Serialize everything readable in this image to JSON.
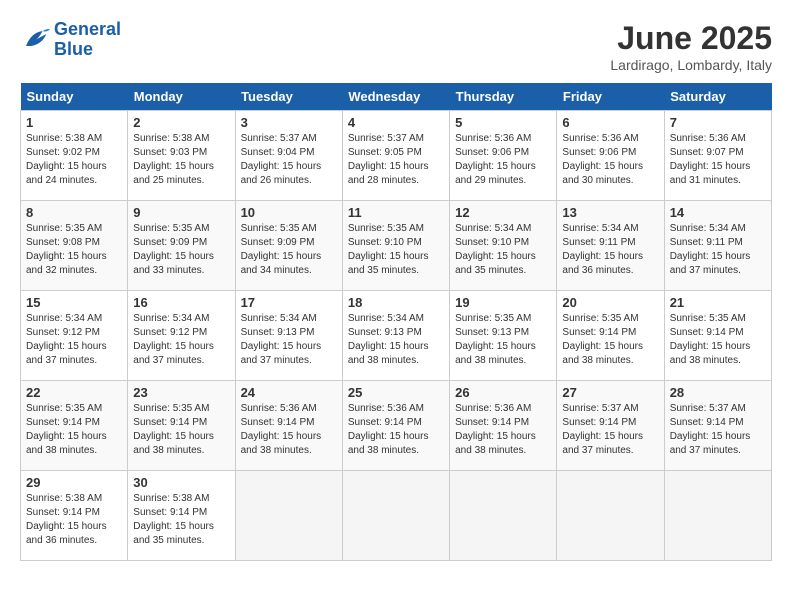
{
  "header": {
    "logo_line1": "General",
    "logo_line2": "Blue",
    "month": "June 2025",
    "location": "Lardirago, Lombardy, Italy"
  },
  "weekdays": [
    "Sunday",
    "Monday",
    "Tuesday",
    "Wednesday",
    "Thursday",
    "Friday",
    "Saturday"
  ],
  "weeks": [
    [
      {
        "day": 1,
        "sunrise": "5:38 AM",
        "sunset": "9:02 PM",
        "daylight": "15 hours and 24 minutes."
      },
      {
        "day": 2,
        "sunrise": "5:38 AM",
        "sunset": "9:03 PM",
        "daylight": "15 hours and 25 minutes."
      },
      {
        "day": 3,
        "sunrise": "5:37 AM",
        "sunset": "9:04 PM",
        "daylight": "15 hours and 26 minutes."
      },
      {
        "day": 4,
        "sunrise": "5:37 AM",
        "sunset": "9:05 PM",
        "daylight": "15 hours and 28 minutes."
      },
      {
        "day": 5,
        "sunrise": "5:36 AM",
        "sunset": "9:06 PM",
        "daylight": "15 hours and 29 minutes."
      },
      {
        "day": 6,
        "sunrise": "5:36 AM",
        "sunset": "9:06 PM",
        "daylight": "15 hours and 30 minutes."
      },
      {
        "day": 7,
        "sunrise": "5:36 AM",
        "sunset": "9:07 PM",
        "daylight": "15 hours and 31 minutes."
      }
    ],
    [
      {
        "day": 8,
        "sunrise": "5:35 AM",
        "sunset": "9:08 PM",
        "daylight": "15 hours and 32 minutes."
      },
      {
        "day": 9,
        "sunrise": "5:35 AM",
        "sunset": "9:09 PM",
        "daylight": "15 hours and 33 minutes."
      },
      {
        "day": 10,
        "sunrise": "5:35 AM",
        "sunset": "9:09 PM",
        "daylight": "15 hours and 34 minutes."
      },
      {
        "day": 11,
        "sunrise": "5:35 AM",
        "sunset": "9:10 PM",
        "daylight": "15 hours and 35 minutes."
      },
      {
        "day": 12,
        "sunrise": "5:34 AM",
        "sunset": "9:10 PM",
        "daylight": "15 hours and 35 minutes."
      },
      {
        "day": 13,
        "sunrise": "5:34 AM",
        "sunset": "9:11 PM",
        "daylight": "15 hours and 36 minutes."
      },
      {
        "day": 14,
        "sunrise": "5:34 AM",
        "sunset": "9:11 PM",
        "daylight": "15 hours and 37 minutes."
      }
    ],
    [
      {
        "day": 15,
        "sunrise": "5:34 AM",
        "sunset": "9:12 PM",
        "daylight": "15 hours and 37 minutes."
      },
      {
        "day": 16,
        "sunrise": "5:34 AM",
        "sunset": "9:12 PM",
        "daylight": "15 hours and 37 minutes."
      },
      {
        "day": 17,
        "sunrise": "5:34 AM",
        "sunset": "9:13 PM",
        "daylight": "15 hours and 37 minutes."
      },
      {
        "day": 18,
        "sunrise": "5:34 AM",
        "sunset": "9:13 PM",
        "daylight": "15 hours and 38 minutes."
      },
      {
        "day": 19,
        "sunrise": "5:35 AM",
        "sunset": "9:13 PM",
        "daylight": "15 hours and 38 minutes."
      },
      {
        "day": 20,
        "sunrise": "5:35 AM",
        "sunset": "9:14 PM",
        "daylight": "15 hours and 38 minutes."
      },
      {
        "day": 21,
        "sunrise": "5:35 AM",
        "sunset": "9:14 PM",
        "daylight": "15 hours and 38 minutes."
      }
    ],
    [
      {
        "day": 22,
        "sunrise": "5:35 AM",
        "sunset": "9:14 PM",
        "daylight": "15 hours and 38 minutes."
      },
      {
        "day": 23,
        "sunrise": "5:35 AM",
        "sunset": "9:14 PM",
        "daylight": "15 hours and 38 minutes."
      },
      {
        "day": 24,
        "sunrise": "5:36 AM",
        "sunset": "9:14 PM",
        "daylight": "15 hours and 38 minutes."
      },
      {
        "day": 25,
        "sunrise": "5:36 AM",
        "sunset": "9:14 PM",
        "daylight": "15 hours and 38 minutes."
      },
      {
        "day": 26,
        "sunrise": "5:36 AM",
        "sunset": "9:14 PM",
        "daylight": "15 hours and 38 minutes."
      },
      {
        "day": 27,
        "sunrise": "5:37 AM",
        "sunset": "9:14 PM",
        "daylight": "15 hours and 37 minutes."
      },
      {
        "day": 28,
        "sunrise": "5:37 AM",
        "sunset": "9:14 PM",
        "daylight": "15 hours and 37 minutes."
      }
    ],
    [
      {
        "day": 29,
        "sunrise": "5:38 AM",
        "sunset": "9:14 PM",
        "daylight": "15 hours and 36 minutes."
      },
      {
        "day": 30,
        "sunrise": "5:38 AM",
        "sunset": "9:14 PM",
        "daylight": "15 hours and 35 minutes."
      },
      null,
      null,
      null,
      null,
      null
    ]
  ]
}
